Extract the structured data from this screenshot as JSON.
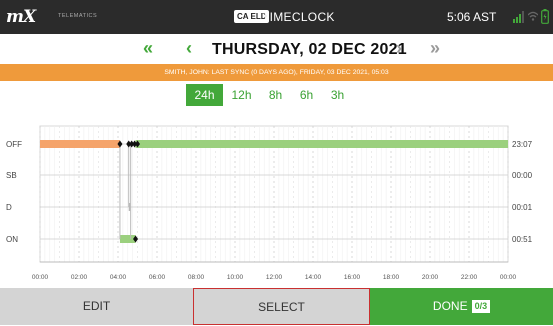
{
  "app": {
    "logo_text": "mX",
    "logo_subtitle": "TELEMATICS",
    "eld_badge": "CA ELD",
    "title": "TIMECLOCK",
    "time": "5:06 AST"
  },
  "date_nav": {
    "prev_week_icon": "double-chevron-left",
    "prev_day_icon": "chevron-left",
    "date": "THURSDAY, 02 DEC 2021",
    "next_day_icon": "chevron-right",
    "next_week_icon": "double-chevron-right"
  },
  "sync_status": "SMITH, JOHN: LAST SYNC (0 DAYS AGO), FRIDAY, 03 DEC 2021, 05:03",
  "range_tabs": [
    {
      "label": "24h",
      "active": true
    },
    {
      "label": "12h",
      "active": false
    },
    {
      "label": "8h",
      "active": false
    },
    {
      "label": "6h",
      "active": false
    },
    {
      "label": "3h",
      "active": false
    }
  ],
  "chart_data": {
    "type": "line",
    "x_ticks": [
      "00:00",
      "02:00",
      "04:00",
      "06:00",
      "08:00",
      "10:00",
      "12:00",
      "14:00",
      "16:00",
      "18:00",
      "20:00",
      "22:00",
      "00:00"
    ],
    "xlim": [
      0,
      24
    ],
    "statuses": [
      "OFF",
      "SB",
      "D",
      "ON"
    ],
    "totals": {
      "OFF": "23:07",
      "SB": "00:00",
      "D": "00:01",
      "ON": "00:51"
    },
    "segments": [
      {
        "status": "OFF",
        "start": 0.0,
        "end": 4.1,
        "color": "#f5a46b"
      },
      {
        "status": "ON",
        "start": 4.1,
        "end": 4.9,
        "color": "#9bd07e"
      },
      {
        "status": "D",
        "start": 4.55,
        "end": 4.6,
        "color": "#b9b9b9"
      },
      {
        "status": "OFF",
        "start": 4.9,
        "end": 24.0,
        "color": "#9bd07e"
      }
    ],
    "event_markers": [
      {
        "status": "OFF",
        "time": 4.1
      },
      {
        "status": "ON",
        "time": 4.9
      },
      {
        "status": "OFF",
        "time": 4.55
      },
      {
        "status": "OFF",
        "time": 4.7
      },
      {
        "status": "OFF",
        "time": 4.85
      },
      {
        "status": "OFF",
        "time": 5.0
      }
    ],
    "colors": {
      "off_before": "#f5a46b",
      "active": "#9bd07e",
      "marker": "#111111",
      "transition": "#b9b9b9"
    }
  },
  "footer": {
    "edit_label": "EDIT",
    "select_label": "SELECT",
    "done_label": "DONE",
    "done_count": "0/3"
  }
}
